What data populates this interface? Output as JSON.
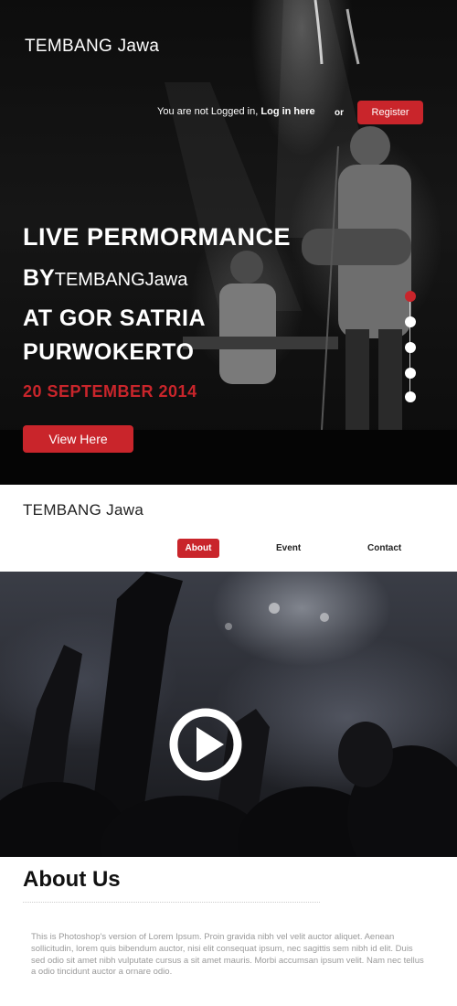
{
  "header": {
    "brand": "TEMBANG Jawa",
    "login_text": "You are not Logged in,",
    "login_link": "Log in here",
    "or_text": "or",
    "register_label": "Register"
  },
  "hero": {
    "line1": "LIVE PERMORMANCE",
    "line2_by": "BY",
    "line2_brand": "TEMBANGJawa",
    "line3": "AT GOR SATRIA",
    "line4": "PURWOKERTO",
    "date": "20 SEPTEMBER 2014",
    "cta_label": "View Here",
    "slides": {
      "count": 5,
      "active_index": 0
    }
  },
  "nav": {
    "brand": "TEMBANG Jawa",
    "items": [
      {
        "label": "About",
        "active": true
      },
      {
        "label": "Event",
        "active": false
      },
      {
        "label": "Contact",
        "active": false
      }
    ]
  },
  "video": {
    "icon": "play-icon"
  },
  "about": {
    "title": "About Us",
    "body": "This is Photoshop's version of Lorem Ipsum. Proin gravida nibh vel velit auctor aliquet. Aenean sollicitudin, lorem quis bibendum auctor, nisi elit consequat ipsum, nec sagittis sem nibh id elit. Duis sed odio sit amet nibh vulputate cursus a sit amet mauris. Morbi accumsan ipsum velit. Nam nec tellus a odio tincidunt auctor a ornare odio."
  },
  "colors": {
    "accent": "#c9252b",
    "hero_bg": "#111111",
    "text_dark": "#222222",
    "body_text": "#9a9a9a"
  }
}
